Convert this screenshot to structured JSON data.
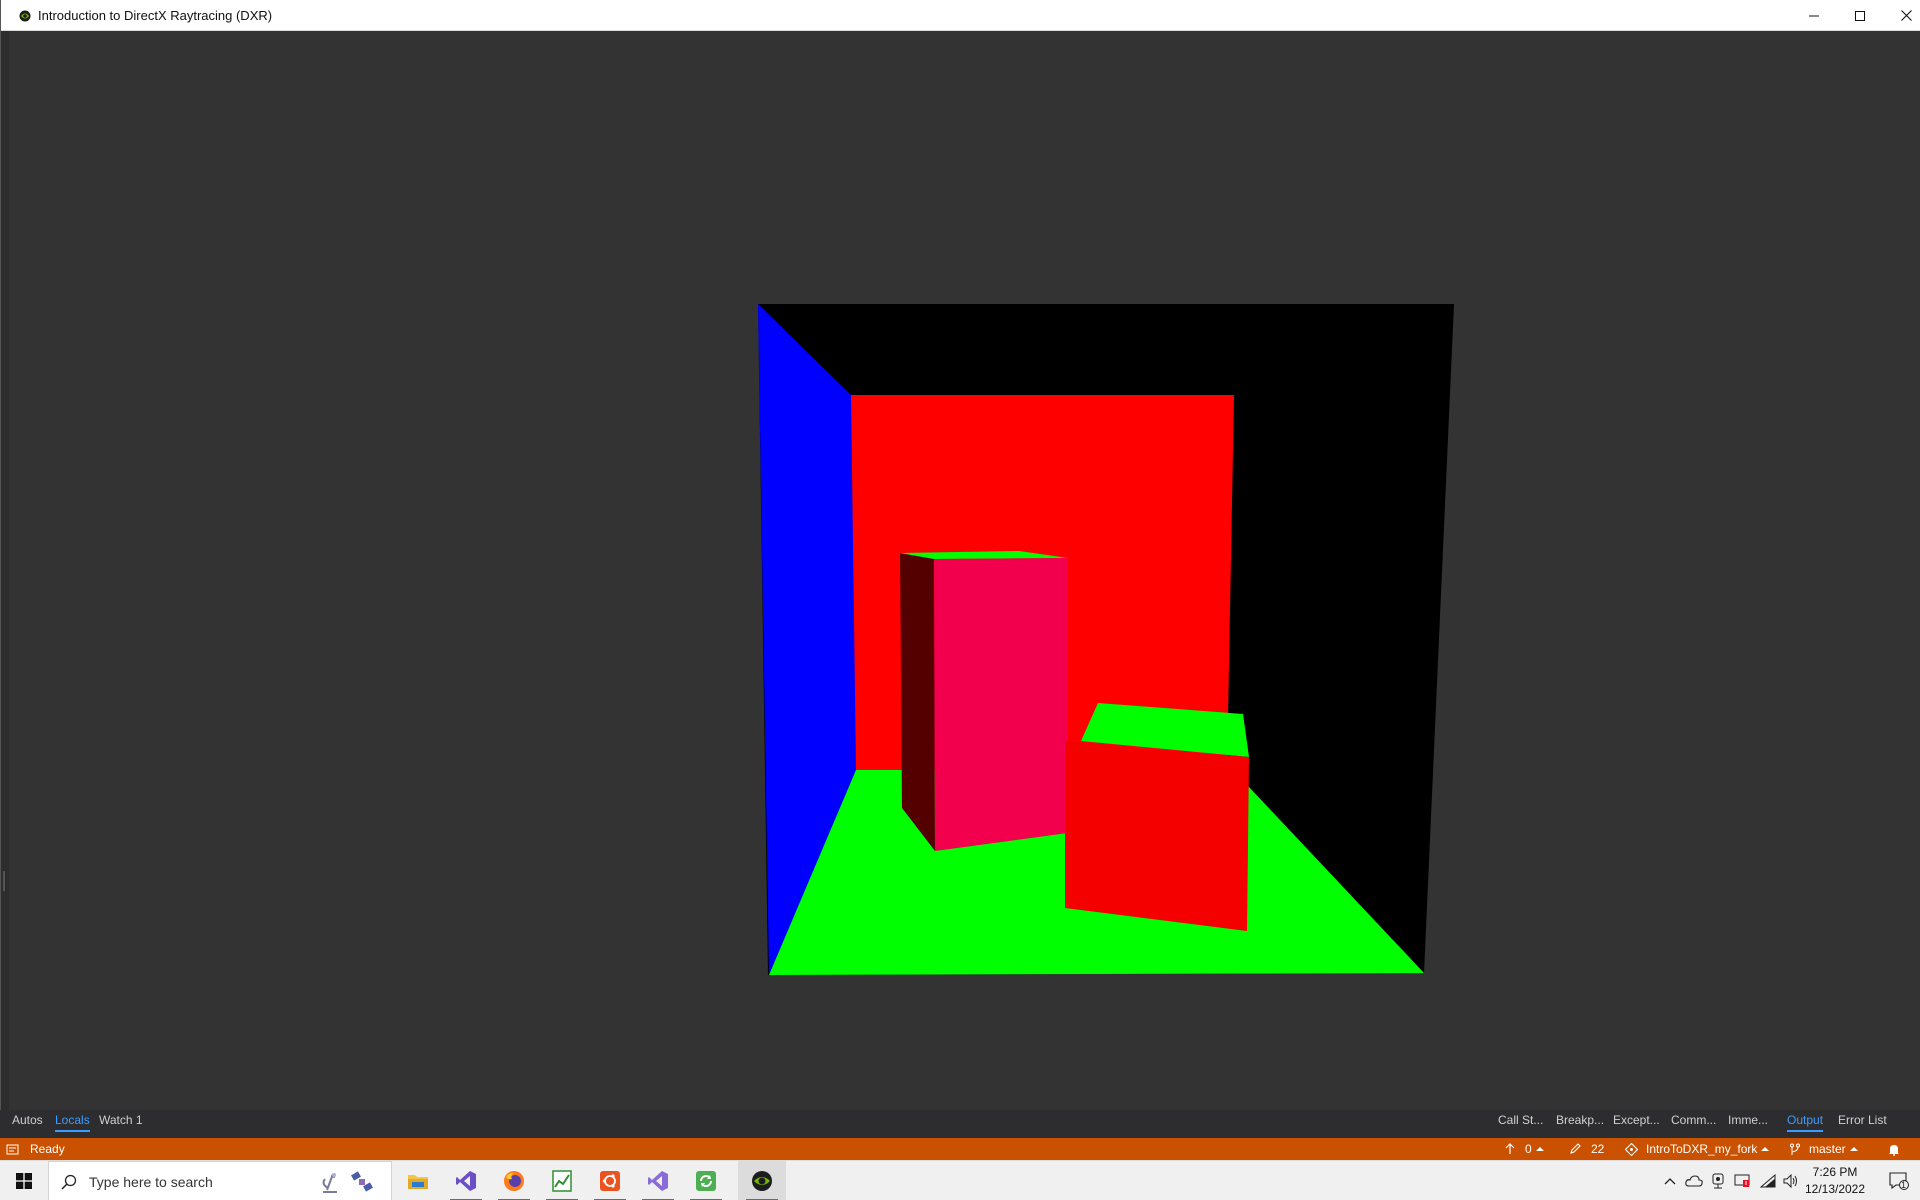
{
  "window": {
    "title": "Introduction to DirectX Raytracing (DXR)"
  },
  "colors": {
    "client_bg": "#333333",
    "status_bar": "#ca5100",
    "active_tab": "#3b9cff",
    "wall_left": "#0000ff",
    "wall_back": "#ff0000",
    "floor": "#00ff00",
    "wall_right": "#000000",
    "tall_box_front": "#f2004d",
    "tall_box_side": "#550000",
    "short_box_front": "#f40000"
  },
  "scene": {
    "name": "cornell-box-render"
  },
  "debug_tabs": {
    "left": [
      "Autos",
      "Locals",
      "Watch 1"
    ],
    "right": [
      "Call St...",
      "Breakp...",
      "Except...",
      "Comm...",
      "Imme...",
      "Output",
      "Error List"
    ],
    "active": [
      "Locals",
      "Output"
    ]
  },
  "status_bar": {
    "state": "Ready",
    "push_count": "0",
    "changes_count": "22",
    "repo": "IntroToDXR_my_fork",
    "branch": "master"
  },
  "taskbar": {
    "search_placeholder": "Type here to search",
    "apps": [
      "file-explorer",
      "visual-studio",
      "firefox",
      "task-manager",
      "ubuntu",
      "visual-studio-preview",
      "app-green",
      "dxr-app"
    ],
    "time": "7:26 PM",
    "date": "12/13/2022",
    "notification_count": "1"
  }
}
